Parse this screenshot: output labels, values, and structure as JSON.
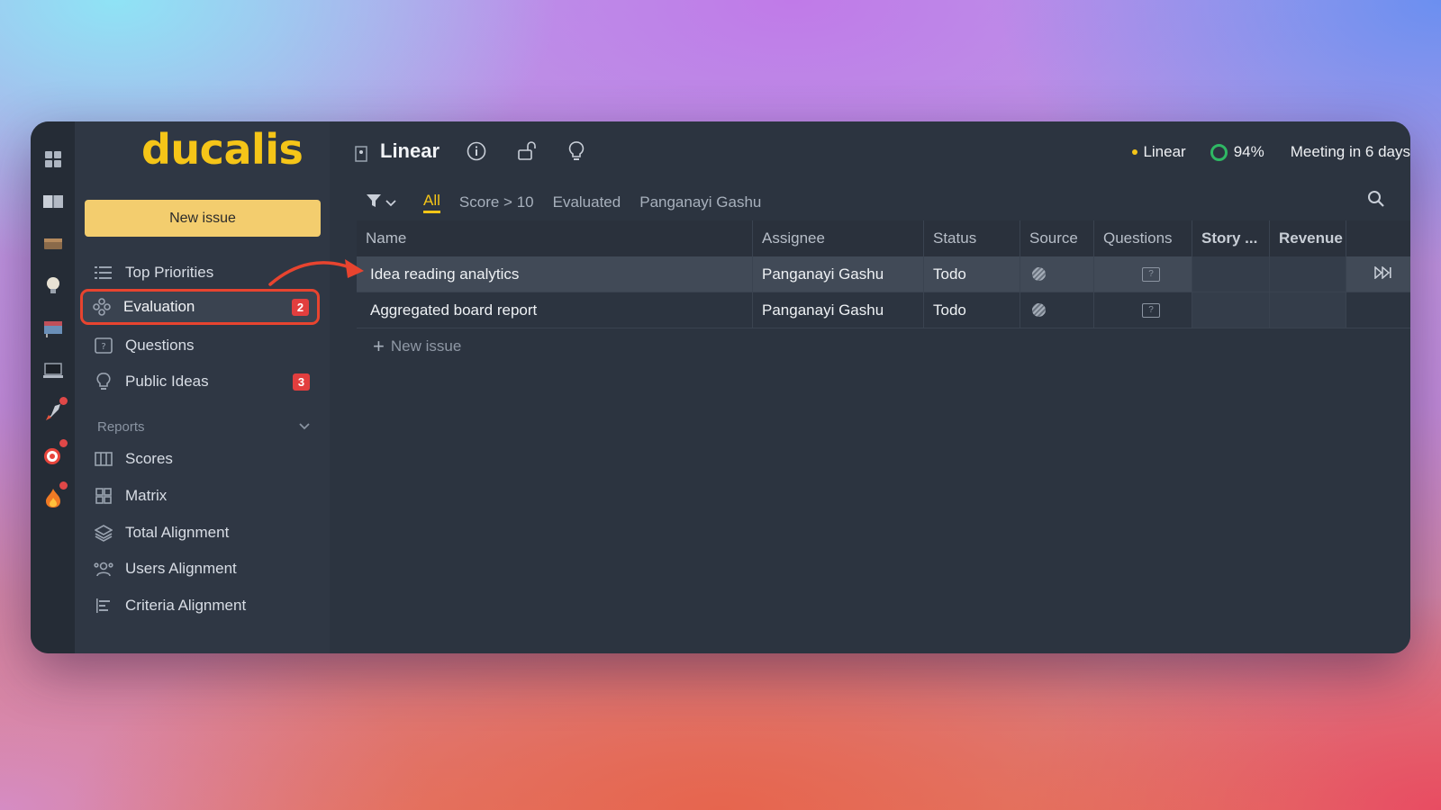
{
  "app": {
    "logo": "ducalis",
    "board_title": "Linear",
    "integration_label": "Linear",
    "progress_label": "94%",
    "meeting_label": "Meeting in 6 days",
    "accent": "#f5c518"
  },
  "sidebar": {
    "new_issue_label": "New issue",
    "items": [
      {
        "label": "Top Priorities",
        "icon": "list-icon"
      },
      {
        "label": "Evaluation",
        "icon": "evaluation-icon",
        "badge": "2",
        "active": true
      },
      {
        "label": "Questions",
        "icon": "question-icon"
      },
      {
        "label": "Public Ideas",
        "icon": "lightbulb-icon",
        "badge": "3"
      }
    ],
    "reports_label": "Reports",
    "reports": [
      {
        "label": "Scores",
        "icon": "columns-icon"
      },
      {
        "label": "Matrix",
        "icon": "grid-icon"
      },
      {
        "label": "Total Alignment",
        "icon": "layers-icon"
      },
      {
        "label": "Users Alignment",
        "icon": "users-icon"
      },
      {
        "label": "Criteria Alignment",
        "icon": "bars-icon"
      }
    ]
  },
  "filters": {
    "tabs": [
      "All",
      "Score > 10",
      "Evaluated",
      "Panganayi Gashu"
    ],
    "active": "All"
  },
  "table": {
    "columns": [
      "Name",
      "Assignee",
      "Status",
      "Source",
      "Questions",
      "Story ...",
      "Revenue"
    ],
    "rows": [
      {
        "name": "Idea reading analytics",
        "assignee": "Panganayi Gashu",
        "status": "Todo"
      },
      {
        "name": "Aggregated board report",
        "assignee": "Panganayi Gashu",
        "status": "Todo"
      }
    ],
    "add_label": "New issue"
  }
}
